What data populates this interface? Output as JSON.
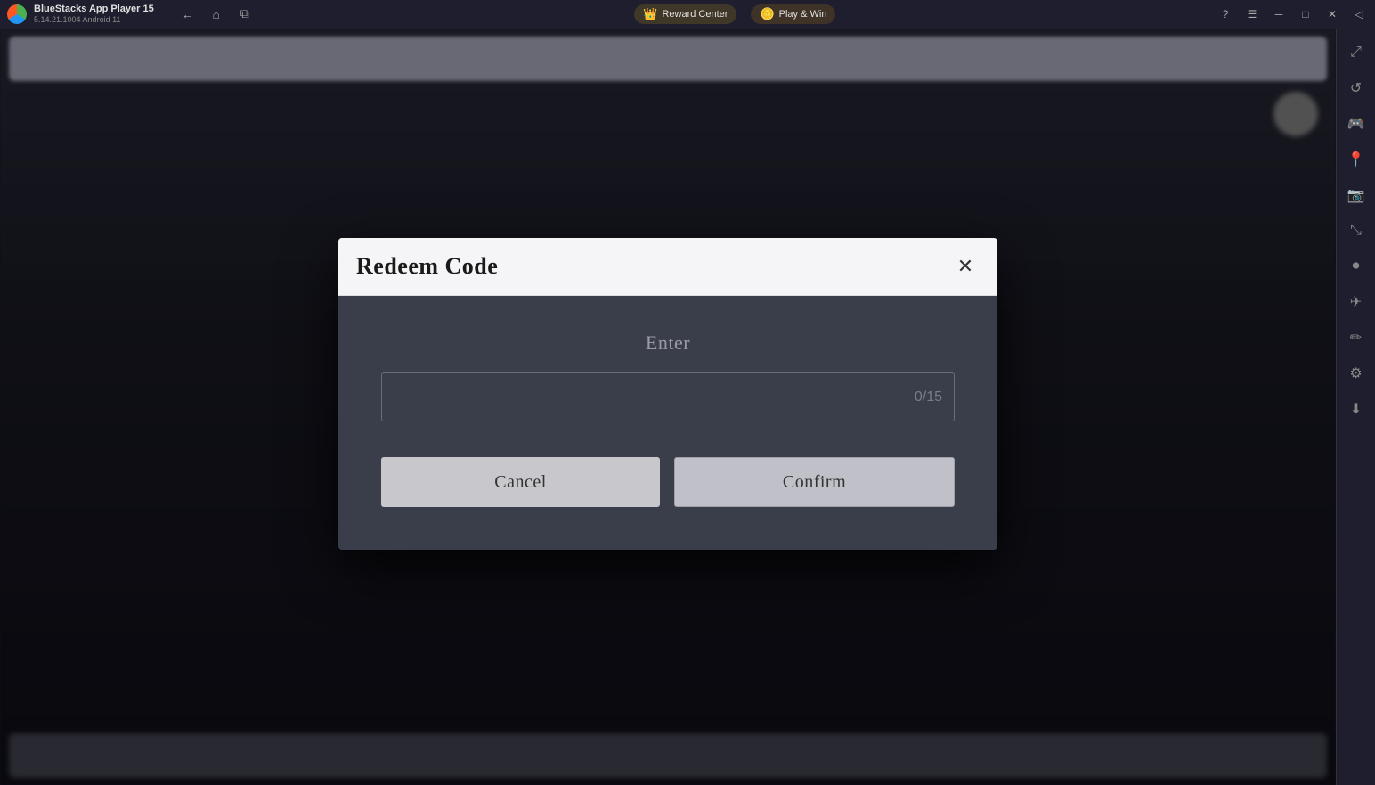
{
  "titlebar": {
    "app_name": "BlueStacks App Player 15",
    "app_version": "5.14.21.1004  Android 11",
    "nav": {
      "back_label": "←",
      "home_label": "⌂",
      "copy_label": "⧉"
    },
    "reward_center": {
      "label": "Reward Center",
      "icon": "👑"
    },
    "play_win": {
      "label": "Play & Win",
      "icon": "🪙"
    },
    "window_controls": {
      "help": "?",
      "menu": "☰",
      "minimize": "─",
      "maximize": "□",
      "close": "✕",
      "sidebar_toggle": "◁"
    }
  },
  "sidebar": {
    "icons": [
      {
        "name": "expand-icon",
        "glyph": "⤢"
      },
      {
        "name": "rotate-icon",
        "glyph": "↺"
      },
      {
        "name": "gamepad-icon",
        "glyph": "🎮"
      },
      {
        "name": "location-icon",
        "glyph": "📍"
      },
      {
        "name": "camera-icon",
        "glyph": "📷"
      },
      {
        "name": "resize-icon",
        "glyph": "⤡"
      },
      {
        "name": "macro-icon",
        "glyph": "⏺"
      },
      {
        "name": "plane-icon",
        "glyph": "✈"
      },
      {
        "name": "edit-icon",
        "glyph": "✏"
      },
      {
        "name": "settings-icon",
        "glyph": "⚙"
      },
      {
        "name": "download-icon",
        "glyph": "⬇"
      }
    ]
  },
  "dialog": {
    "title": "Redeem Code",
    "close_label": "✕",
    "enter_label": "Enter",
    "input_placeholder": "",
    "input_value": "",
    "char_count": "0/15",
    "cancel_label": "Cancel",
    "confirm_label": "Confirm"
  }
}
